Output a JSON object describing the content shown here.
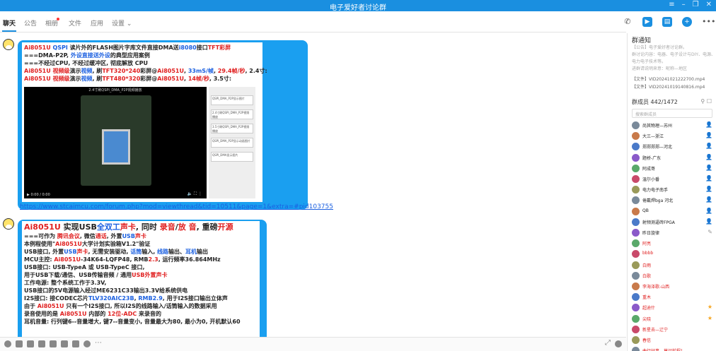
{
  "window": {
    "title": "电子爱好者讨论群",
    "controls": [
      "≡",
      "–",
      "❐",
      "✕"
    ]
  },
  "tabs": [
    {
      "label": "聊天",
      "active": true
    },
    {
      "label": "公告"
    },
    {
      "label": "相册"
    },
    {
      "label": "文件"
    },
    {
      "label": "应用"
    },
    {
      "label": "设置 ⌄"
    }
  ],
  "header_icons": [
    "phone-icon",
    "video-call-icon",
    "notes-icon",
    "add-icon",
    "more-icon"
  ],
  "message1": {
    "lines": [
      [
        [
          "r",
          "Ai8051U "
        ],
        [
          "b",
          "QSPI"
        ],
        [
          "k",
          " 读片外的FLASH图片字库文件直接DMA送"
        ],
        [
          "b",
          "i8080"
        ],
        [
          "k",
          "接口"
        ],
        [
          "r",
          "TFT彩屏"
        ]
      ],
      [
        [
          "k",
          "===DMA-P2P, "
        ],
        [
          "b",
          "外设直接送外设"
        ],
        [
          "k",
          "的典型应用案例"
        ]
      ],
      [
        [
          "k",
          "===不经过CPU, 不经过缓冲区, 彻底解放 CPU"
        ]
      ],
      [
        [
          "r",
          "Ai8051U 视频级"
        ],
        [
          "k",
          "演示"
        ],
        [
          "b",
          "视频"
        ],
        [
          "k",
          ", 刷"
        ],
        [
          "r",
          "TFT320*240"
        ],
        [
          "k",
          "彩屏@"
        ],
        [
          "r",
          "Ai8051U"
        ],
        [
          "k",
          ", "
        ],
        [
          "b",
          "33mS/帧"
        ],
        [
          "k",
          ", "
        ],
        [
          "r",
          "29.4帧/秒"
        ],
        [
          "k",
          ", 2.4寸:"
        ]
      ],
      [
        [
          "r",
          "Ai8051U 视频级"
        ],
        [
          "k",
          "演示"
        ],
        [
          "b",
          "视频"
        ],
        [
          "k",
          ", 刷"
        ],
        [
          "r",
          "TFT480*320"
        ],
        [
          "k",
          "彩屏@"
        ],
        [
          "r",
          "Ai8051U"
        ],
        [
          "k",
          ", "
        ],
        [
          "r",
          "14帧/秒"
        ],
        [
          "k",
          ", 3.5寸:"
        ]
      ]
    ],
    "video_title": "2.4寸刷QSPI_DMA_P2P视频播放",
    "video_time": "0:00 / 0:00",
    "playlist": [
      "QSPI_DMA_P2P显示图片",
      "2.4寸刷QSPI_DMA_P2P视频播放",
      "3.5寸刷QSPI_DMA_P2P视频播放",
      "QSPI_DMA_P2P显示动画图片",
      "QSPI_DMA显示图片"
    ],
    "link": "https://www.stcaimcu.com/forum.php?mod=viewthread&tid=10511&page=1&extra=#pid103755"
  },
  "message2": {
    "lines": [
      [
        [
          "r",
          "Ai8051U"
        ],
        [
          "k",
          " 实现USB"
        ],
        [
          "b",
          "全双工"
        ],
        [
          "r",
          "声卡"
        ],
        [
          "k",
          ", 同时 "
        ],
        [
          "r",
          "录音"
        ],
        [
          "k",
          "/"
        ],
        [
          "r",
          "放 音"
        ],
        [
          "k",
          ", 重磅"
        ],
        [
          "r",
          "开源"
        ]
      ],
      [
        [
          "k",
          "===可作为 "
        ],
        [
          "r",
          "腾讯会议"
        ],
        [
          "k",
          ", 微信"
        ],
        [
          "r",
          "通话"
        ],
        [
          "k",
          ", 外置"
        ],
        [
          "b",
          "USB"
        ],
        [
          "r",
          "声卡"
        ]
      ],
      [
        [
          "k",
          "本例程使用\""
        ],
        [
          "r",
          "Ai8051U"
        ],
        [
          "k",
          "大学计划实验箱V1.2\"验证"
        ]
      ],
      [
        [
          "k",
          "USB接口, 外置"
        ],
        [
          "b",
          "USB"
        ],
        [
          "r",
          "声卡"
        ],
        [
          "k",
          ", 无需安装驱动, "
        ],
        [
          "b",
          "话筒"
        ],
        [
          "k",
          "输入, "
        ],
        [
          "b",
          "线路"
        ],
        [
          "k",
          "输出、"
        ],
        [
          "b",
          "耳机"
        ],
        [
          "k",
          "输出"
        ]
      ],
      [
        [
          "k",
          "MCU主控:  "
        ],
        [
          "r",
          "Ai8051U"
        ],
        [
          "k",
          "-34K64-LQFP48, RMB"
        ],
        [
          "r",
          "2.3"
        ],
        [
          "k",
          ", 运行频率36.864MHz"
        ]
      ],
      [
        [
          "k",
          "USB接口:  USB-TypeA 或 USB-TypeC 接口,"
        ]
      ],
      [
        [
          "k",
          "               用于USB下载/通信、USB传输音频 / 通用"
        ],
        [
          "r",
          "USB外置声卡"
        ]
      ],
      [
        [
          "k",
          "工作电源:  整个系统工作于3.3V,"
        ]
      ],
      [
        [
          "k",
          "               USB接口的5V电源输入经过ME6231C33输出3.3V给系统供电"
        ]
      ],
      [
        [
          "k",
          "I2S接口:  接CODEC芯片"
        ],
        [
          "b",
          "TLV320AIC23B"
        ],
        [
          "k",
          ", "
        ],
        [
          "b",
          "RMB2.9"
        ],
        [
          "k",
          ", 用于I2S接口输出立体声"
        ]
      ],
      [
        [
          "k",
          "               由于 "
        ],
        [
          "r",
          "Ai8051U"
        ],
        [
          "k",
          " 只有一个I2S接口, 所以I2S的线路输入/话筒输入的数据采用"
        ]
      ],
      [
        [
          "k",
          "               录音使用的是 "
        ],
        [
          "r",
          "Ai8051U"
        ],
        [
          "k",
          " 内部的 "
        ],
        [
          "r",
          "12位-ADC"
        ],
        [
          "k",
          " 来录音的"
        ]
      ],
      [
        [
          "k",
          "耳机音量:  行列键6--音量增大, 键7--音量变小, 音量最大为80, 最小为0, 开机默认60"
        ]
      ]
    ]
  },
  "toolbar_icons": [
    "emoji-icon",
    "gif-icon",
    "screenshot-icon",
    "folder-icon",
    "file-icon",
    "image-icon",
    "voice-icon",
    "bell-icon",
    "more-icon"
  ],
  "sidebar": {
    "notice_title": "群通知",
    "notices": [
      "【公告】电子爱好者讨论群。",
      "群讨论内容：电器、电子设计与DIY、电源、",
      "电力电子技术等。",
      "进群请说明来意：昵称—地区",
      "【文件】VID20241021222700.mp4",
      "【文件】VID20241019140816.mp4"
    ],
    "members_title": "群成员 442/1472",
    "search_placeholder": "搜索群成员",
    "members": [
      {
        "name": "尚其物理—苏州",
        "badge": "owner"
      },
      {
        "name": "大三—浙江",
        "badge": "admin"
      },
      {
        "name": "郑郑郑郑—河北",
        "badge": "admin"
      },
      {
        "name": "题桥-广东",
        "badge": "admin"
      },
      {
        "name": "阿成哥",
        "badge": "admin"
      },
      {
        "name": "温尔小番",
        "badge": "admin"
      },
      {
        "name": "电力电子南手",
        "badge": "admin"
      },
      {
        "name": "倦戴焊bga 河北",
        "badge": "admin"
      },
      {
        "name": "QB",
        "badge": "admin"
      },
      {
        "name": "射频测逼砖FPGA",
        "badge": "admin"
      },
      {
        "name": "昨日旋律",
        "badge": "edit"
      },
      {
        "name": "阿亮",
        "color": "#e02020"
      },
      {
        "name": "bbbb",
        "color": "#e02020"
      },
      {
        "name": "白雨",
        "color": "#e02020"
      },
      {
        "name": "白歌",
        "color": "#e02020"
      },
      {
        "name": "李海泽歌-山西",
        "color": "#e02020"
      },
      {
        "name": "重木",
        "color": "#e02020"
      },
      {
        "name": "超迪什",
        "color": "#e02020",
        "badge": "star"
      },
      {
        "name": "尖晓",
        "color": "#e02020",
        "badge": "star"
      },
      {
        "name": "新星去—辽宁",
        "color": "#e02020"
      },
      {
        "name": "春信",
        "color": "#e02020"
      },
      {
        "name": "曲行好事、莫问前程！",
        "color": "#e02020"
      }
    ]
  },
  "colors": {
    "accent": "#1a8fe0",
    "red": "#e02020",
    "blue": "#1a5fe0",
    "bubble_band": "#1a9ff0"
  }
}
